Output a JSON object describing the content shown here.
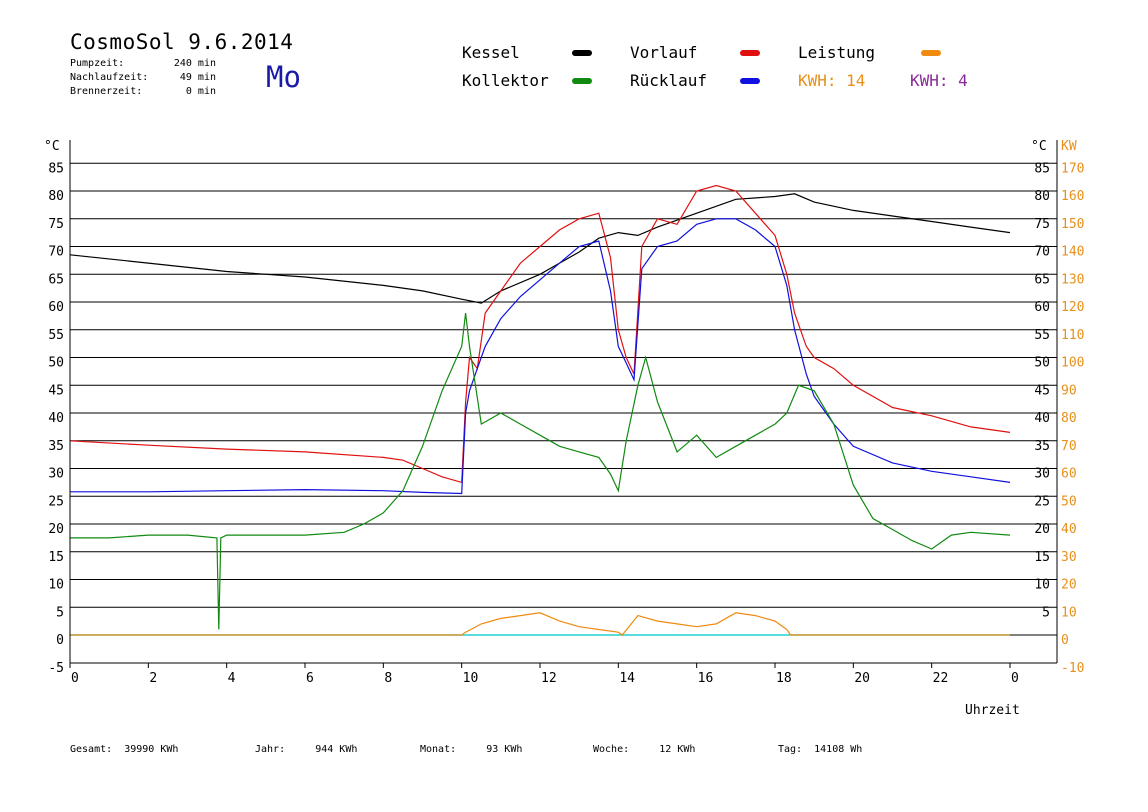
{
  "header": {
    "title": "CosmoSol 9.6.2014",
    "weekday": "Mo",
    "info": [
      {
        "label": "Pumpzeit:",
        "value": "240 min"
      },
      {
        "label": "Nachlaufzeit:",
        "value": "49 min"
      },
      {
        "label": "Brennerzeit:",
        "value": "0 min"
      }
    ]
  },
  "legend": {
    "kessel": {
      "label": "Kessel",
      "color": "#000000"
    },
    "vorlauf": {
      "label": "Vorlauf",
      "color": "#e01010"
    },
    "leistung": {
      "label": "Leistung",
      "color": "#f08a10"
    },
    "kollektor": {
      "label": "Kollektor",
      "color": "#108a10"
    },
    "ruecklauf": {
      "label": "Rücklauf",
      "color": "#1010e0"
    },
    "kwh1": {
      "label": "KWH: 14",
      "color": "#e8901a"
    },
    "kwh2": {
      "label": "KWH: 4",
      "color": "#8a2a9a"
    }
  },
  "footer": {
    "gesamt": {
      "label": "Gesamt:",
      "value": "39990 KWh"
    },
    "jahr": {
      "label": "Jahr:",
      "value": "944 KWh"
    },
    "monat": {
      "label": "Monat:",
      "value": "93 KWh"
    },
    "woche": {
      "label": "Woche:",
      "value": "12 KWh"
    },
    "tag": {
      "label": "Tag:",
      "value": "14108 Wh"
    }
  },
  "chart_data": {
    "type": "line",
    "xlabel": "Uhrzeit",
    "ylabel_left": "°C",
    "ylabel_right_temp": "°C",
    "ylabel_right_power": "KW",
    "xlim": [
      0,
      24
    ],
    "ylim": [
      -5,
      90
    ],
    "x_ticks": [
      "0",
      "2",
      "4",
      "6",
      "8",
      "10",
      "12",
      "14",
      "16",
      "18",
      "20",
      "22",
      "0"
    ],
    "y_ticks_left": [
      "85",
      "80",
      "75",
      "70",
      "65",
      "60",
      "55",
      "50",
      "45",
      "40",
      "35",
      "30",
      "25",
      "20",
      "15",
      "10",
      "5",
      "0",
      "-5"
    ],
    "y_ticks_right_temp": [
      "85",
      "80",
      "75",
      "70",
      "65",
      "60",
      "55",
      "50",
      "45",
      "40",
      "35",
      "30",
      "25",
      "20",
      "15",
      "10",
      "5"
    ],
    "y_ticks_right_power": [
      "170",
      "160",
      "150",
      "140",
      "130",
      "120",
      "110",
      "100",
      "90",
      "80",
      "70",
      "60",
      "50",
      "40",
      "30",
      "20",
      "10",
      "0",
      "-10"
    ],
    "grid": true,
    "series": [
      {
        "name": "Kessel",
        "color": "#000000",
        "x": [
          0,
          2,
          4,
          6,
          8,
          9,
          10,
          10.5,
          11,
          12,
          12.5,
          13,
          13.5,
          14,
          14.5,
          15,
          16,
          17,
          18,
          18.5,
          19,
          20,
          21,
          22,
          23,
          24
        ],
        "y": [
          68.5,
          67,
          65.5,
          64.5,
          63,
          62,
          60.5,
          59.8,
          62,
          65,
          67,
          69,
          71.5,
          72.5,
          72,
          73.5,
          76,
          78.5,
          79,
          79.5,
          78,
          76.5,
          75.5,
          74.5,
          73.5,
          72.5
        ]
      },
      {
        "name": "Vorlauf",
        "color": "#e01010",
        "x": [
          0,
          2,
          4,
          6,
          8,
          8.5,
          9,
          9.5,
          10,
          10.1,
          10.2,
          10.4,
          10.6,
          11,
          11.5,
          12,
          12.5,
          13,
          13.5,
          13.8,
          14,
          14.2,
          14.4,
          14.6,
          15,
          15.5,
          16,
          16.5,
          17,
          17.5,
          18,
          18.3,
          18.5,
          18.8,
          19,
          19.5,
          20,
          21,
          22,
          23,
          24
        ],
        "y": [
          35,
          34.2,
          33.5,
          33,
          32,
          31.5,
          30,
          28.5,
          27.5,
          42,
          50,
          48,
          58,
          62,
          67,
          70,
          73,
          75,
          76,
          68,
          55,
          50,
          47,
          70,
          75,
          74,
          80,
          81,
          80,
          76,
          72,
          65,
          58,
          52,
          50,
          48,
          45,
          41,
          39.5,
          37.5,
          36.5
        ]
      },
      {
        "name": "Rücklauf",
        "color": "#1010e0",
        "x": [
          0,
          2,
          4,
          6,
          8,
          9,
          10,
          10.1,
          10.2,
          10.4,
          10.6,
          11,
          11.5,
          12,
          12.5,
          13,
          13.5,
          13.8,
          14,
          14.2,
          14.4,
          14.6,
          15,
          15.5,
          16,
          16.5,
          17,
          17.5,
          18,
          18.3,
          18.5,
          18.8,
          19,
          19.5,
          20,
          21,
          22,
          23,
          24
        ],
        "y": [
          25.8,
          25.8,
          26,
          26.2,
          26,
          25.7,
          25.5,
          40,
          44,
          48,
          52,
          57,
          61,
          64,
          67,
          70,
          71,
          62,
          52,
          49,
          46,
          66,
          70,
          71,
          74,
          75,
          75,
          73,
          70,
          63,
          55,
          47,
          43,
          38,
          34,
          31,
          29.5,
          28.5,
          27.5
        ]
      },
      {
        "name": "Kollektor",
        "color": "#108a10",
        "x": [
          0,
          1,
          2,
          3,
          3.75,
          3.8,
          3.85,
          4,
          5,
          6,
          7,
          7.5,
          8,
          8.5,
          9,
          9.5,
          10,
          10.1,
          10.2,
          10.5,
          11,
          11.5,
          12,
          12.5,
          13,
          13.5,
          13.8,
          14,
          14.2,
          14.5,
          14.7,
          15,
          15.5,
          16,
          16.5,
          17,
          17.5,
          18,
          18.3,
          18.6,
          19,
          19.5,
          20,
          20.5,
          21,
          21.5,
          22,
          22.5,
          23,
          24
        ],
        "y": [
          17.5,
          17.5,
          18,
          18,
          17.5,
          1,
          17.5,
          18,
          18,
          18,
          18.5,
          20,
          22,
          26,
          34,
          44,
          52,
          58,
          52,
          38,
          40,
          38,
          36,
          34,
          33,
          32,
          29,
          26,
          35,
          45,
          50,
          42,
          33,
          36,
          32,
          34,
          36,
          38,
          40,
          45,
          44,
          38,
          27,
          21,
          19,
          17,
          15.5,
          18,
          18.5,
          18
        ]
      },
      {
        "name": "Leistung",
        "color": "#f08a10",
        "x": [
          0,
          10,
          10.1,
          10.5,
          11,
          11.5,
          12,
          12.5,
          13,
          13.5,
          14,
          14.1,
          14.5,
          15,
          15.5,
          16,
          16.5,
          17,
          17.5,
          18,
          18.3,
          18.4,
          24
        ],
        "y": [
          0,
          0,
          0.5,
          2,
          3,
          3.5,
          4,
          2.5,
          1.5,
          1,
          0.5,
          0,
          3.5,
          2.5,
          2,
          1.5,
          2,
          4,
          3.5,
          2.5,
          1,
          0,
          0
        ]
      }
    ]
  }
}
